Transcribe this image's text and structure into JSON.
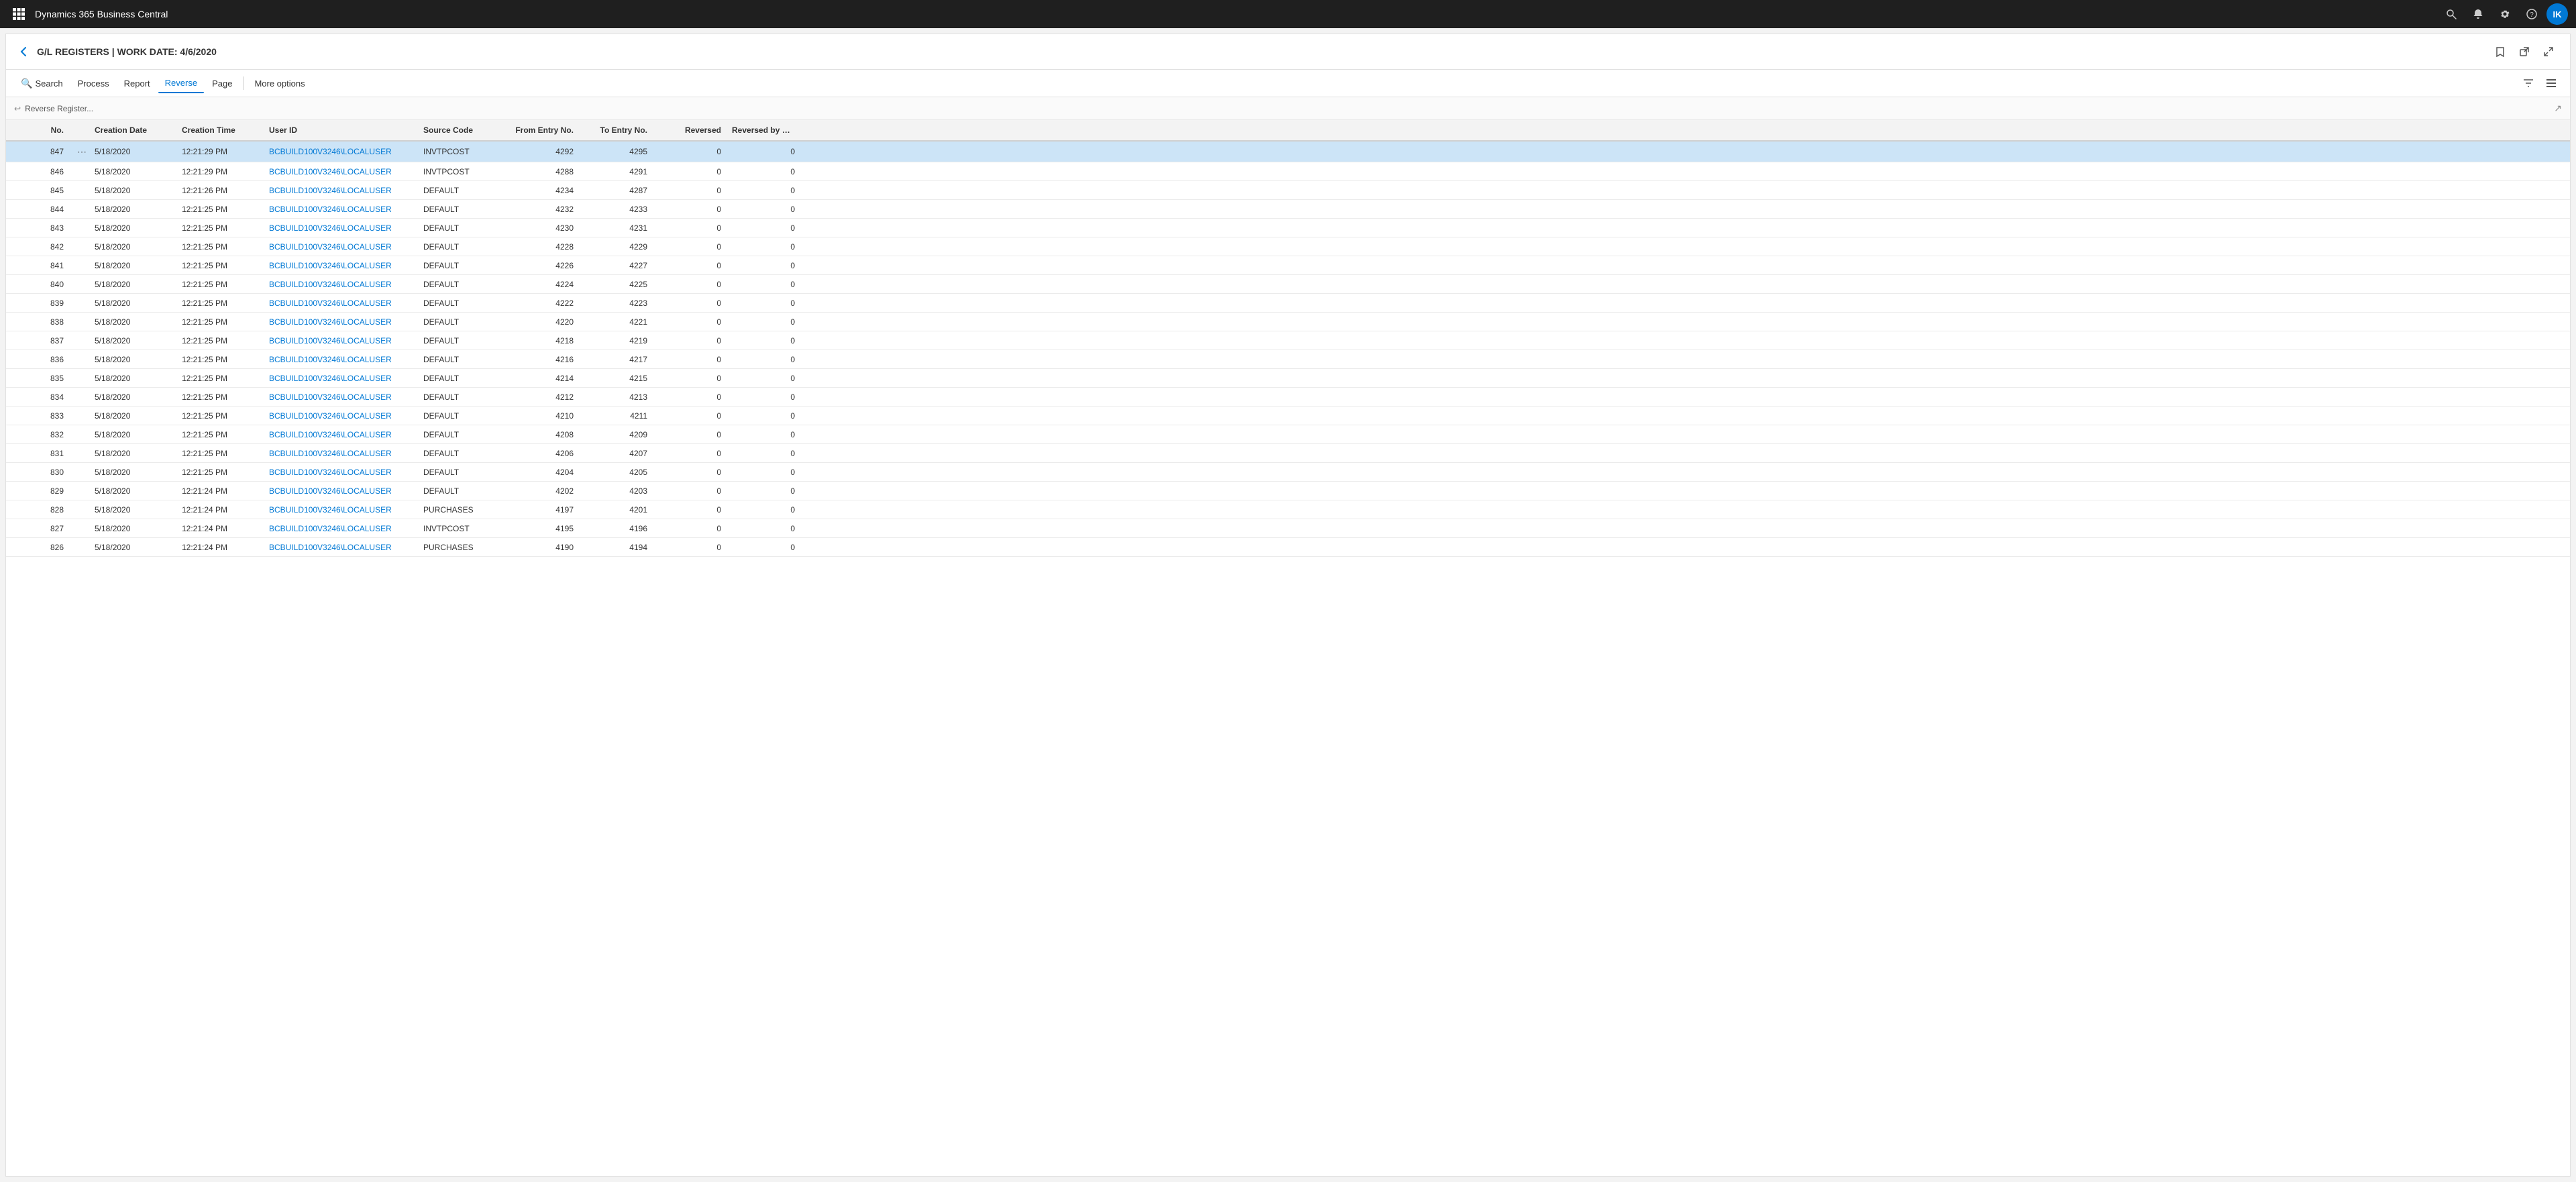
{
  "app": {
    "title": "Dynamics 365 Business Central"
  },
  "topbar": {
    "title": "Dynamics 365 Business Central",
    "icons": [
      "search",
      "bell",
      "gear",
      "help",
      "user"
    ],
    "user_initials": "IK"
  },
  "page": {
    "title": "G/L REGISTERS",
    "subtitle": "WORK DATE: 4/6/2020",
    "breadcrumb": "G/L REGISTERS | WORK DATE: 4/6/2020"
  },
  "toolbar": {
    "buttons": [
      {
        "id": "search",
        "label": "Search",
        "icon": "🔍"
      },
      {
        "id": "process",
        "label": "Process",
        "icon": ""
      },
      {
        "id": "report",
        "label": "Report",
        "icon": ""
      },
      {
        "id": "reverse",
        "label": "Reverse",
        "icon": "",
        "active": true
      },
      {
        "id": "page",
        "label": "Page",
        "icon": ""
      },
      {
        "id": "more",
        "label": "More options",
        "icon": ""
      }
    ]
  },
  "filter_bar": {
    "placeholder": "Reverse Register...",
    "icon": "↩"
  },
  "table": {
    "columns": [
      {
        "id": "no",
        "label": "No.",
        "align": "right"
      },
      {
        "id": "menu",
        "label": "",
        "align": "center"
      },
      {
        "id": "creation_date",
        "label": "Creation Date",
        "align": "left"
      },
      {
        "id": "creation_time",
        "label": "Creation Time",
        "align": "left"
      },
      {
        "id": "user_id",
        "label": "User ID",
        "align": "left"
      },
      {
        "id": "source_code",
        "label": "Source Code",
        "align": "left"
      },
      {
        "id": "from_entry",
        "label": "From Entry No.",
        "align": "right"
      },
      {
        "id": "to_entry",
        "label": "To Entry No.",
        "align": "right"
      },
      {
        "id": "reversed",
        "label": "Reversed",
        "align": "right"
      },
      {
        "id": "reversed_by",
        "label": "Reversed by Reg. No.",
        "align": "right"
      }
    ],
    "rows": [
      {
        "no": "847",
        "menu": true,
        "creation_date": "5/18/2020",
        "creation_time": "12:21:29 PM",
        "user_id": "BCBUILD100V3246\\LOCALUSER",
        "source_code": "INVTPCOST",
        "from_entry": "4292",
        "to_entry": "4295",
        "reversed": "0",
        "reversed_by": "0",
        "selected": true
      },
      {
        "no": "846",
        "menu": false,
        "creation_date": "5/18/2020",
        "creation_time": "12:21:29 PM",
        "user_id": "BCBUILD100V3246\\LOCALUSER",
        "source_code": "INVTPCOST",
        "from_entry": "4288",
        "to_entry": "4291",
        "reversed": "0",
        "reversed_by": "0",
        "selected": false
      },
      {
        "no": "845",
        "menu": false,
        "creation_date": "5/18/2020",
        "creation_time": "12:21:26 PM",
        "user_id": "BCBUILD100V3246\\LOCALUSER",
        "source_code": "DEFAULT",
        "from_entry": "4234",
        "to_entry": "4287",
        "reversed": "0",
        "reversed_by": "0",
        "selected": false
      },
      {
        "no": "844",
        "menu": false,
        "creation_date": "5/18/2020",
        "creation_time": "12:21:25 PM",
        "user_id": "BCBUILD100V3246\\LOCALUSER",
        "source_code": "DEFAULT",
        "from_entry": "4232",
        "to_entry": "4233",
        "reversed": "0",
        "reversed_by": "0",
        "selected": false
      },
      {
        "no": "843",
        "menu": false,
        "creation_date": "5/18/2020",
        "creation_time": "12:21:25 PM",
        "user_id": "BCBUILD100V3246\\LOCALUSER",
        "source_code": "DEFAULT",
        "from_entry": "4230",
        "to_entry": "4231",
        "reversed": "0",
        "reversed_by": "0",
        "selected": false
      },
      {
        "no": "842",
        "menu": false,
        "creation_date": "5/18/2020",
        "creation_time": "12:21:25 PM",
        "user_id": "BCBUILD100V3246\\LOCALUSER",
        "source_code": "DEFAULT",
        "from_entry": "4228",
        "to_entry": "4229",
        "reversed": "0",
        "reversed_by": "0",
        "selected": false
      },
      {
        "no": "841",
        "menu": false,
        "creation_date": "5/18/2020",
        "creation_time": "12:21:25 PM",
        "user_id": "BCBUILD100V3246\\LOCALUSER",
        "source_code": "DEFAULT",
        "from_entry": "4226",
        "to_entry": "4227",
        "reversed": "0",
        "reversed_by": "0",
        "selected": false
      },
      {
        "no": "840",
        "menu": false,
        "creation_date": "5/18/2020",
        "creation_time": "12:21:25 PM",
        "user_id": "BCBUILD100V3246\\LOCALUSER",
        "source_code": "DEFAULT",
        "from_entry": "4224",
        "to_entry": "4225",
        "reversed": "0",
        "reversed_by": "0",
        "selected": false
      },
      {
        "no": "839",
        "menu": false,
        "creation_date": "5/18/2020",
        "creation_time": "12:21:25 PM",
        "user_id": "BCBUILD100V3246\\LOCALUSER",
        "source_code": "DEFAULT",
        "from_entry": "4222",
        "to_entry": "4223",
        "reversed": "0",
        "reversed_by": "0",
        "selected": false
      },
      {
        "no": "838",
        "menu": false,
        "creation_date": "5/18/2020",
        "creation_time": "12:21:25 PM",
        "user_id": "BCBUILD100V3246\\LOCALUSER",
        "source_code": "DEFAULT",
        "from_entry": "4220",
        "to_entry": "4221",
        "reversed": "0",
        "reversed_by": "0",
        "selected": false
      },
      {
        "no": "837",
        "menu": false,
        "creation_date": "5/18/2020",
        "creation_time": "12:21:25 PM",
        "user_id": "BCBUILD100V3246\\LOCALUSER",
        "source_code": "DEFAULT",
        "from_entry": "4218",
        "to_entry": "4219",
        "reversed": "0",
        "reversed_by": "0",
        "selected": false
      },
      {
        "no": "836",
        "menu": false,
        "creation_date": "5/18/2020",
        "creation_time": "12:21:25 PM",
        "user_id": "BCBUILD100V3246\\LOCALUSER",
        "source_code": "DEFAULT",
        "from_entry": "4216",
        "to_entry": "4217",
        "reversed": "0",
        "reversed_by": "0",
        "selected": false
      },
      {
        "no": "835",
        "menu": false,
        "creation_date": "5/18/2020",
        "creation_time": "12:21:25 PM",
        "user_id": "BCBUILD100V3246\\LOCALUSER",
        "source_code": "DEFAULT",
        "from_entry": "4214",
        "to_entry": "4215",
        "reversed": "0",
        "reversed_by": "0",
        "selected": false
      },
      {
        "no": "834",
        "menu": false,
        "creation_date": "5/18/2020",
        "creation_time": "12:21:25 PM",
        "user_id": "BCBUILD100V3246\\LOCALUSER",
        "source_code": "DEFAULT",
        "from_entry": "4212",
        "to_entry": "4213",
        "reversed": "0",
        "reversed_by": "0",
        "selected": false
      },
      {
        "no": "833",
        "menu": false,
        "creation_date": "5/18/2020",
        "creation_time": "12:21:25 PM",
        "user_id": "BCBUILD100V3246\\LOCALUSER",
        "source_code": "DEFAULT",
        "from_entry": "4210",
        "to_entry": "4211",
        "reversed": "0",
        "reversed_by": "0",
        "selected": false
      },
      {
        "no": "832",
        "menu": false,
        "creation_date": "5/18/2020",
        "creation_time": "12:21:25 PM",
        "user_id": "BCBUILD100V3246\\LOCALUSER",
        "source_code": "DEFAULT",
        "from_entry": "4208",
        "to_entry": "4209",
        "reversed": "0",
        "reversed_by": "0",
        "selected": false
      },
      {
        "no": "831",
        "menu": false,
        "creation_date": "5/18/2020",
        "creation_time": "12:21:25 PM",
        "user_id": "BCBUILD100V3246\\LOCALUSER",
        "source_code": "DEFAULT",
        "from_entry": "4206",
        "to_entry": "4207",
        "reversed": "0",
        "reversed_by": "0",
        "selected": false
      },
      {
        "no": "830",
        "menu": false,
        "creation_date": "5/18/2020",
        "creation_time": "12:21:25 PM",
        "user_id": "BCBUILD100V3246\\LOCALUSER",
        "source_code": "DEFAULT",
        "from_entry": "4204",
        "to_entry": "4205",
        "reversed": "0",
        "reversed_by": "0",
        "selected": false
      },
      {
        "no": "829",
        "menu": false,
        "creation_date": "5/18/2020",
        "creation_time": "12:21:24 PM",
        "user_id": "BCBUILD100V3246\\LOCALUSER",
        "source_code": "DEFAULT",
        "from_entry": "4202",
        "to_entry": "4203",
        "reversed": "0",
        "reversed_by": "0",
        "selected": false
      },
      {
        "no": "828",
        "menu": false,
        "creation_date": "5/18/2020",
        "creation_time": "12:21:24 PM",
        "user_id": "BCBUILD100V3246\\LOCALUSER",
        "source_code": "PURCHASES",
        "from_entry": "4197",
        "to_entry": "4201",
        "reversed": "0",
        "reversed_by": "0",
        "selected": false
      },
      {
        "no": "827",
        "menu": false,
        "creation_date": "5/18/2020",
        "creation_time": "12:21:24 PM",
        "user_id": "BCBUILD100V3246\\LOCALUSER",
        "source_code": "INVTPCOST",
        "from_entry": "4195",
        "to_entry": "4196",
        "reversed": "0",
        "reversed_by": "0",
        "selected": false
      },
      {
        "no": "826",
        "menu": false,
        "creation_date": "5/18/2020",
        "creation_time": "12:21:24 PM",
        "user_id": "BCBUILD100V3246\\LOCALUSER",
        "source_code": "PURCHASES",
        "from_entry": "4190",
        "to_entry": "4194",
        "reversed": "0",
        "reversed_by": "0",
        "selected": false
      }
    ]
  }
}
